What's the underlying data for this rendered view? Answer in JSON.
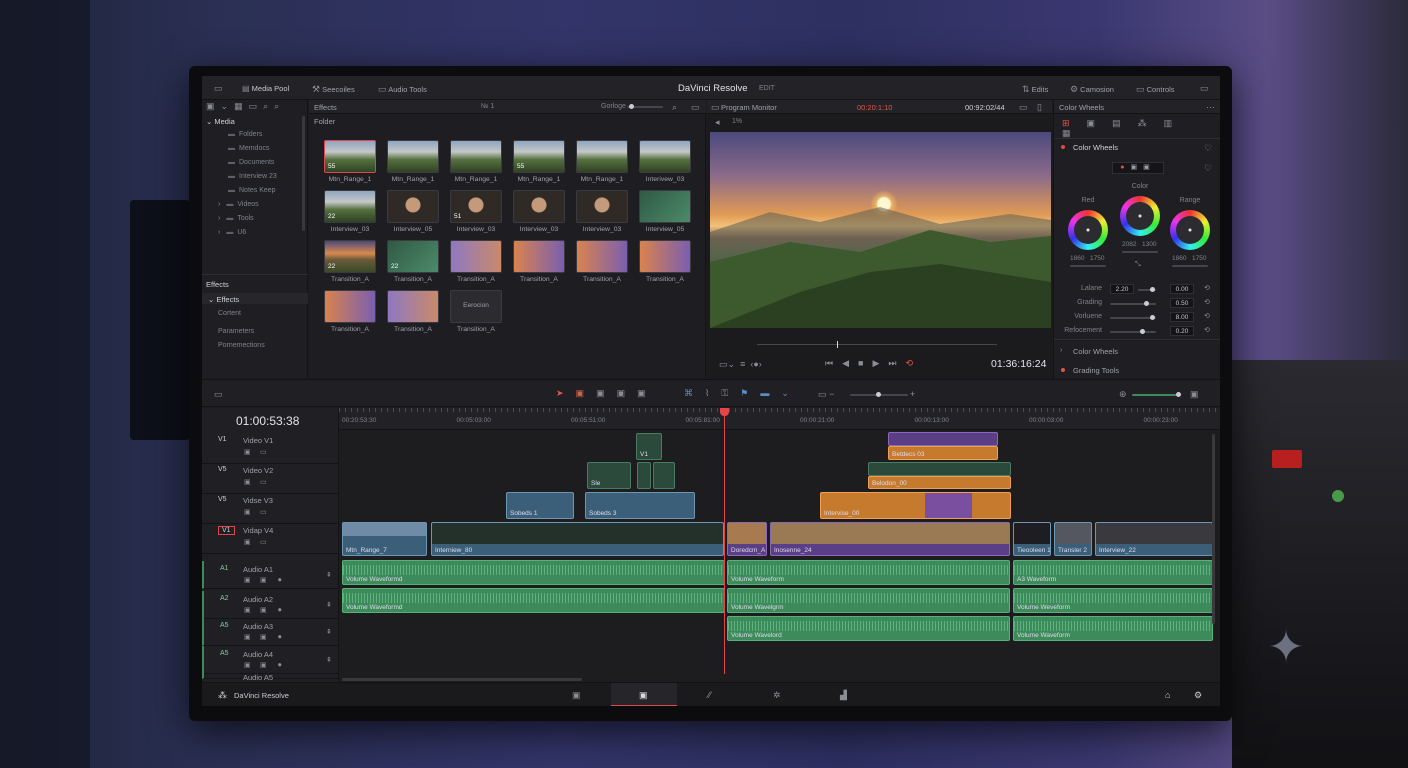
{
  "titlebar": {
    "app_title": "DaVinci Resolve",
    "page": "EDIT",
    "tabs_left": [
      "Media Pool",
      "Seecoiles",
      "Audio Tools"
    ],
    "tabs_right": [
      "Edits",
      "Camosion",
      "Controls"
    ]
  },
  "media_pool": {
    "header": "Media",
    "folders": [
      "Folders",
      "Memdocs",
      "Documents",
      "Interview 23",
      "Notes Keep",
      "Videos",
      "Tools",
      "U6"
    ],
    "effects_header": "Effects",
    "effects_items": [
      "Effects",
      "Cortent",
      "Parameters",
      "Pornemections"
    ]
  },
  "browser": {
    "title": "Effects",
    "folder_label": "Folder",
    "zoom_label": "Gorloge",
    "count": "№ 1",
    "items": [
      {
        "num": "55",
        "caption": "Mtn_Range_1",
        "style": "mtn",
        "selected": true
      },
      {
        "num": "",
        "caption": "Mtn_Range_1",
        "style": "mtn"
      },
      {
        "num": "",
        "caption": "Mtn_Range_1",
        "style": "mtn"
      },
      {
        "num": "55",
        "caption": "Mtn_Range_1",
        "style": "mtn"
      },
      {
        "num": "",
        "caption": "Mtn_Range_1",
        "style": "mtn"
      },
      {
        "num": "",
        "caption": "Interivew_03",
        "style": "mtn"
      },
      {
        "num": "22",
        "caption": "Interview_03",
        "style": "mtn"
      },
      {
        "num": "",
        "caption": "Interview_05",
        "style": "face"
      },
      {
        "num": "51",
        "caption": "Interview_03",
        "style": "face"
      },
      {
        "num": "",
        "caption": "Interview_03",
        "style": "face"
      },
      {
        "num": "",
        "caption": "Interview_03",
        "style": "face"
      },
      {
        "num": "",
        "caption": "Interview_05",
        "style": "grn"
      },
      {
        "num": "22",
        "caption": "Transition_A",
        "style": "sunset"
      },
      {
        "num": "22",
        "caption": "Transition_A",
        "style": "grn"
      },
      {
        "num": "",
        "caption": "Transition_A",
        "style": "trB"
      },
      {
        "num": "",
        "caption": "Transition_A",
        "style": "trA"
      },
      {
        "num": "",
        "caption": "Transition_A",
        "style": "trA"
      },
      {
        "num": "",
        "caption": "Transition_A",
        "style": "trA"
      },
      {
        "num": "",
        "caption": "Transition_A",
        "style": "trA"
      },
      {
        "num": "",
        "caption": "Transition_A",
        "style": "trB"
      },
      {
        "num": "",
        "caption": "Transition_A",
        "style": "blank",
        "inner": "Eerocion"
      }
    ]
  },
  "program_monitor": {
    "title": "Program Monitor",
    "timecode_red": "00:20:1:10",
    "timecode": "00:92:02/44",
    "zoom": "1%",
    "current_tc": "01:36:16:24"
  },
  "color_panel": {
    "title": "Color Wheels",
    "section": "Color Wheels",
    "wheels": [
      {
        "label": "Red",
        "v1": "1860",
        "v2": "1750"
      },
      {
        "label": "Color",
        "v1": "2082",
        "v2": "1300"
      },
      {
        "label": "Range",
        "v1": "1860",
        "v2": "1750"
      }
    ],
    "params": [
      {
        "label": "Lalane",
        "value": "2.20",
        "out": "0.00"
      },
      {
        "label": "Grading",
        "value": "",
        "out": "0.50"
      },
      {
        "label": "Vorluene",
        "value": "",
        "out": "8.00"
      },
      {
        "label": "Refocement",
        "value": "",
        "out": "0.20"
      }
    ],
    "footer": [
      "Color Wheels",
      "Grading Tools"
    ]
  },
  "timeline": {
    "timecode": "01:00:53:38",
    "ruler": [
      "00:20:53:30",
      "00:05:03:00",
      "00:05:51:00",
      "00:05:81:00",
      "00:00:21:00",
      "00:00:13:00",
      "00:00:03:00",
      "00:00:23:00"
    ],
    "video_tracks": [
      {
        "id": "V1",
        "name": "Video V1"
      },
      {
        "id": "V5",
        "name": "Video V2"
      },
      {
        "id": "V5",
        "name": "Vidse V3"
      },
      {
        "id": "V1",
        "name": "Vidap V4"
      }
    ],
    "audio_tracks": [
      {
        "id": "A1",
        "name": "Audio A1"
      },
      {
        "id": "A2",
        "name": "Audio A2"
      },
      {
        "id": "A5",
        "name": "Audio A3"
      },
      {
        "id": "A5",
        "name": "Audio A4"
      },
      {
        "id": "",
        "name": "Audio A5"
      }
    ],
    "clip_labels": {
      "v1": "V1",
      "sle": "Sle",
      "bel": "Betdecs 03",
      "bel2": "Belodon_00",
      "int": "Intervise_00",
      "sobes": "Sobeds 1",
      "sobes2": "Sobeds 3",
      "mtn": "Mtn_Range_7",
      "intr": "Interniew_80",
      "dec": "Doredcm_A",
      "intr2": "Inosenne_24",
      "tran": "Tieooleen 1",
      "tran2": "Transler 2",
      "intr3": "Interview_22",
      "vol1": "Volume Waveformd",
      "vol2": "Volume Waveformd",
      "vol3": "Volume Waveform",
      "vol4": "Volume Wavelgrm",
      "vol5": "Volume Wavelord",
      "vol6": "Volume Weveform",
      "vol7": "Volume Waveform",
      "vol8": "A3 Waveform"
    }
  },
  "bottom": {
    "brand": "DaVinci Resolve"
  },
  "colors": {
    "accent_red": "#e0464a",
    "clip_orange": "#c67a2e",
    "clip_purple": "#5a3f86",
    "audio_green": "#3d8a5a"
  }
}
